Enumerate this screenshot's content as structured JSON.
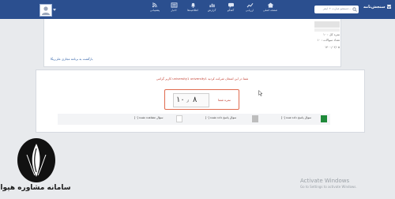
{
  "header": {
    "brand": "سنجش‌نامه",
    "search_placeholder": "جستجو عبارت + اینتر...",
    "nav": [
      {
        "label": "صفحه اصلی",
        "icon": "home-icon"
      },
      {
        "label": "ارزیابی",
        "icon": "chart-icon"
      },
      {
        "label": "گفتگو",
        "icon": "chat-icon"
      },
      {
        "label": "گزارش",
        "icon": "report-icon"
      },
      {
        "label": "اطلاعیه‌ها",
        "icon": "bell-icon"
      },
      {
        "label": "اخبار",
        "icon": "news-icon"
      },
      {
        "label": "پشتیبانی",
        "icon": "rss-icon"
      }
    ]
  },
  "summary": {
    "meta": [
      "نمره کل : ۱۰",
      "تعداد سوالات : ۱۰",
      "۱۴۰۰/۰۲/۰۵"
    ],
    "back_link": "بازگشت به برنامه مجازی علی‌ریگا"
  },
  "result": {
    "message": "کاربر گرامی university1 university1 شما در این امتحان شرکت کردید",
    "score_label": "نمره شما",
    "score_value": "۸",
    "of_word": "از",
    "score_total": "۱۰"
  },
  "legend": [
    {
      "label": "سوال پاسخ داده شده [۰]",
      "color": "#1f8a3a"
    },
    {
      "label": "سوال پاسخ داده نشده [۰]",
      "color": "#bdbdbd"
    },
    {
      "label": "سوال مشاهده نشده [۰]",
      "color": "#ffffff"
    }
  ],
  "logo": {
    "text": "سامانه مشاوره هپوا"
  },
  "watermark": {
    "title": "Activate Windows",
    "subtitle": "Go to Settings to activate Windows."
  },
  "colors": {
    "header": "#2b4f8f",
    "accent": "#c0392b",
    "highlight_border": "#e06b4f"
  }
}
